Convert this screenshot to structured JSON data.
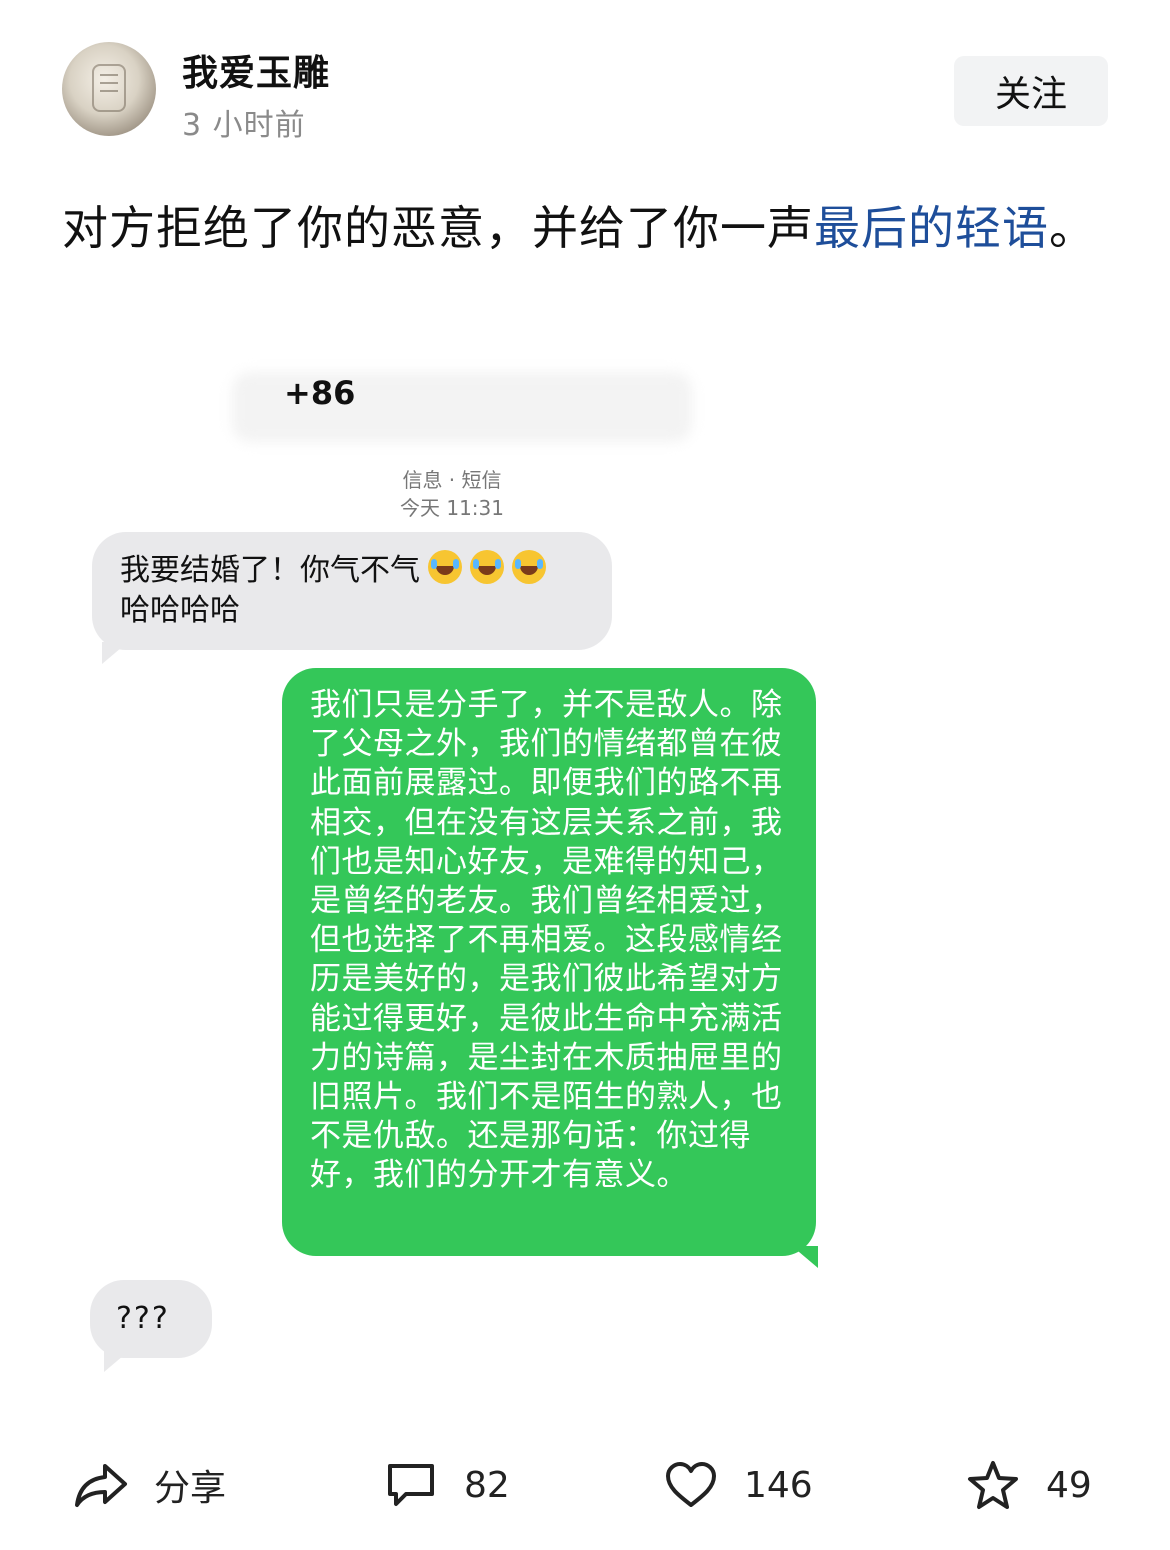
{
  "author": {
    "name": "我爱玉雕",
    "time": "3 小时前",
    "follow_label": "关注"
  },
  "post": {
    "text_main": "对方拒绝了你的恶意，并给了你一声",
    "text_link": "最后的轻语",
    "text_end": "。"
  },
  "screenshot": {
    "phone_prefix": "+86",
    "service_label": "信息 · 短信",
    "timestamp": "今天 11:31",
    "messages": [
      {
        "direction": "incoming",
        "text_line1": "我要结婚了！你气不气",
        "text_line2": "哈哈哈哈",
        "emoji_count": 3
      },
      {
        "direction": "outgoing",
        "text": "我们只是分手了，并不是敌人。除了父母之外，我们的情绪都曾在彼此面前展露过。即便我们的路不再相交，但在没有这层关系之前，我们也是知心好友，是难得的知己，是曾经的老友。我们曾经相爱过，但也选择了不再相爱。这段感情经历是美好的，是我们彼此希望对方能过得更好，是彼此生命中充满活力的诗篇，是尘封在木质抽屉里的旧照片。我们不是陌生的熟人，也不是仇敌。还是那句话：你过得好，我们的分开才有意义。"
      },
      {
        "direction": "incoming",
        "text": "???"
      }
    ]
  },
  "actions": {
    "share_label": "分享",
    "comment_count": "82",
    "like_count": "146",
    "favorite_count": "49"
  },
  "colors": {
    "link": "#1e4e9a",
    "outgoing_bubble": "#34c759",
    "incoming_bubble": "#e9e9eb"
  },
  "icons": [
    "share-icon",
    "comment-icon",
    "like-icon",
    "favorite-icon",
    "laughing-emoji-icon"
  ]
}
